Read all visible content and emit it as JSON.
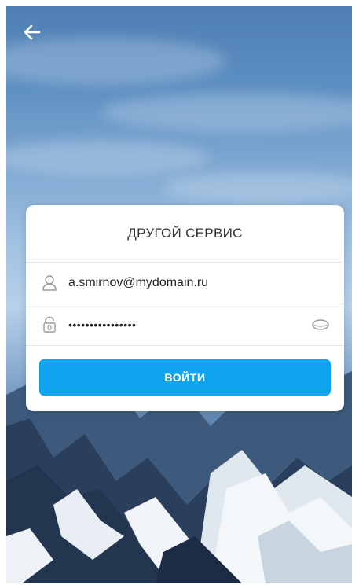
{
  "navigation": {
    "back_icon": "arrow-left-icon"
  },
  "login_card": {
    "title": "ДРУГОЙ СЕРВИС",
    "email_field": {
      "value": "a.smirnov@mydomain.ru",
      "icon": "user-icon"
    },
    "password_field": {
      "value": "••••••••••••••••",
      "icon": "lock-icon",
      "toggle_icon": "eye-icon"
    },
    "login_button_label": "ВОЙТИ"
  },
  "colors": {
    "accent": "#0fa5ee",
    "card_background": "#ffffff",
    "title_text": "#333333"
  }
}
